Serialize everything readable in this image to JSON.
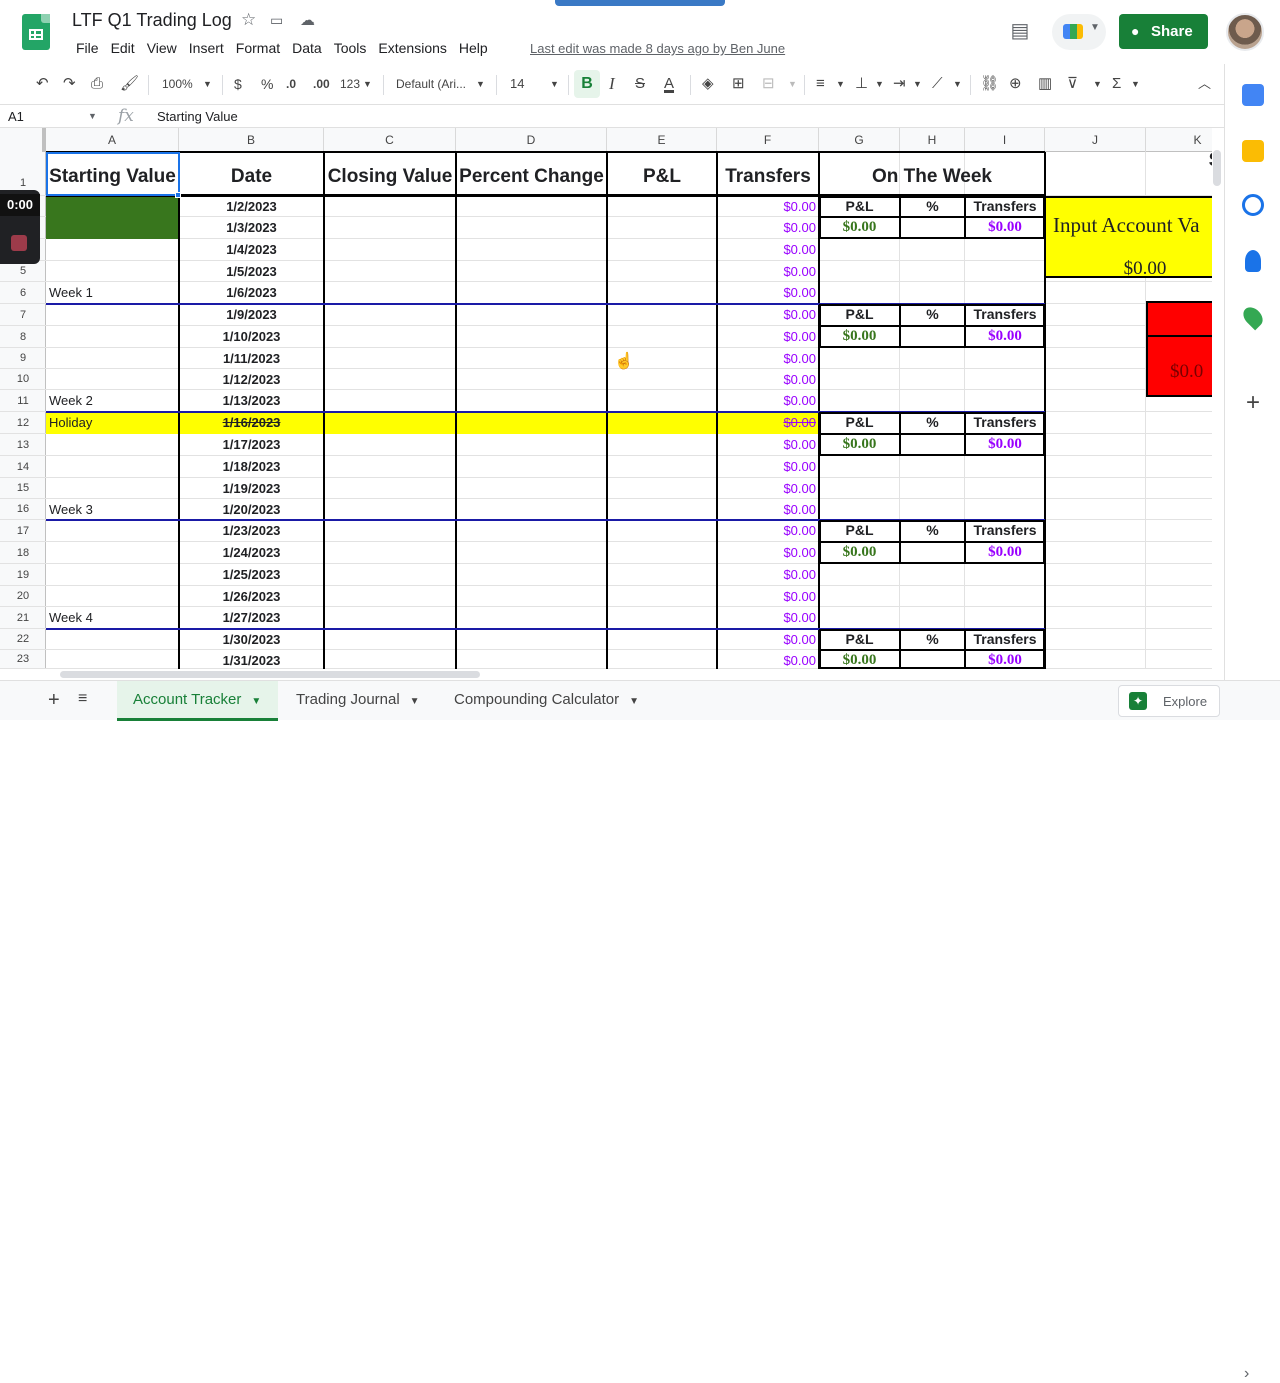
{
  "app": {
    "doc_title": "LTF Q1 Trading Log",
    "menu": [
      "File",
      "Edit",
      "View",
      "Insert",
      "Format",
      "Data",
      "Tools",
      "Extensions",
      "Help"
    ],
    "last_edit": "Last edit was made 8 days ago by Ben June",
    "share_label": "Share"
  },
  "toolbar": {
    "zoom": "100%",
    "currency": "$",
    "percent": "%",
    "dec_decrease": ".0",
    "dec_increase": ".00",
    "more_formats": "123",
    "font": "Default (Ari...",
    "font_size": "14",
    "bold": "B",
    "italic": "I",
    "strike": "S",
    "text_color": "A"
  },
  "formula_bar": {
    "cell_ref": "A1",
    "fx": "fx",
    "value": "Starting Value"
  },
  "recorder": {
    "time": "0:00"
  },
  "columns": [
    "A",
    "B",
    "C",
    "D",
    "E",
    "F",
    "G",
    "H",
    "I",
    "J",
    "K"
  ],
  "rows": [
    "1",
    "2",
    "3",
    "4",
    "5",
    "6",
    "7",
    "8",
    "9",
    "10",
    "11",
    "12",
    "13",
    "14",
    "15",
    "16",
    "17",
    "18",
    "19",
    "20",
    "21",
    "22",
    "23"
  ],
  "headers": {
    "starting_value": "Starting Value",
    "date": "Date",
    "closing_value": "Closing Value",
    "percent_change": "Percent Change",
    "pnl": "P&L",
    "transfers": "Transfers",
    "on_the_week": "On The Week",
    "k_partial": "S"
  },
  "dates": [
    "1/2/2023",
    "1/3/2023",
    "1/4/2023",
    "1/5/2023",
    "1/6/2023",
    "1/9/2023",
    "1/10/2023",
    "1/11/2023",
    "1/12/2023",
    "1/13/2023",
    "1/16/2023",
    "1/17/2023",
    "1/18/2023",
    "1/19/2023",
    "1/20/2023",
    "1/23/2023",
    "1/24/2023",
    "1/25/2023",
    "1/26/2023",
    "1/27/2023",
    "1/30/2023",
    "1/31/2023"
  ],
  "transfer_value": "$0.00",
  "week_labels": [
    "Week 1",
    "Week 2",
    "Holiday",
    "Week 3",
    "Week 4"
  ],
  "week_box": {
    "pnl_label": "P&L",
    "pct_label": "%",
    "transfers_label": "Transfers",
    "pnl_value": "$0.00",
    "transfers_value": "$0.00"
  },
  "input_box": {
    "label": "Input Account Va",
    "value": "$0.00",
    "red_value": "$0.0"
  },
  "sheet_tabs": [
    "Account Tracker",
    "Trading Journal",
    "Compounding Calculator"
  ],
  "explore_label": "Explore",
  "colors": {
    "green_fill": "#38761d",
    "yellow_fill": "#ffff00",
    "red_fill": "#ff0000",
    "purple_text": "#9900ff",
    "brand_green": "#188038"
  }
}
